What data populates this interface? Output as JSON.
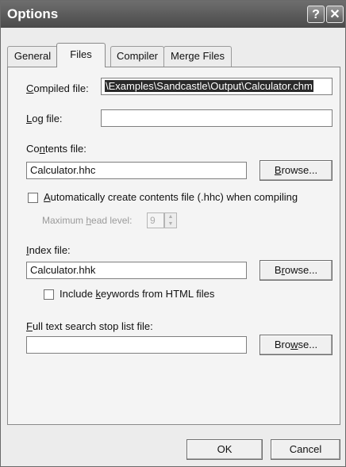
{
  "window": {
    "title": "Options",
    "help_glyph": "?",
    "close_glyph": "✕"
  },
  "tabs": [
    {
      "label": "General",
      "active": false
    },
    {
      "label": "Files",
      "active": true
    },
    {
      "label": "Compiler",
      "active": false
    },
    {
      "label": "Merge Files",
      "active": false
    }
  ],
  "files": {
    "compiled_file": {
      "label_pre": "",
      "label_key": "C",
      "label_post": "ompiled file:",
      "value": "\\Examples\\Sandcastle\\Output\\Calculator.chm"
    },
    "log_file": {
      "label_key": "L",
      "label_post": "og file:",
      "value": ""
    },
    "contents_file": {
      "label_pre": "Co",
      "label_key": "n",
      "label_post": "tents file:",
      "value": "Calculator.hhc",
      "browse_pre": "",
      "browse_key": "B",
      "browse_post": "rowse..."
    },
    "auto_create": {
      "label_pre": "",
      "label_key": "A",
      "label_post": "utomatically create contents file (.hhc) when compiling",
      "checked": false
    },
    "max_head": {
      "label_pre": "Maximum ",
      "label_key": "h",
      "label_post": "ead level:",
      "value": "9",
      "enabled": false
    },
    "index_file": {
      "label_key": "I",
      "label_post": "ndex file:",
      "value": "Calculator.hhk",
      "browse_pre": "B",
      "browse_key": "r",
      "browse_post": "owse..."
    },
    "include_keywords": {
      "label_pre": "Include ",
      "label_key": "k",
      "label_post": "eywords from HTML files",
      "checked": false
    },
    "stop_list": {
      "label_key": "F",
      "label_post": "ull text search stop list file:",
      "value": "",
      "browse_pre": "Bro",
      "browse_key": "w",
      "browse_post": "se..."
    }
  },
  "footer": {
    "ok_label": "OK",
    "cancel_label": "Cancel"
  }
}
